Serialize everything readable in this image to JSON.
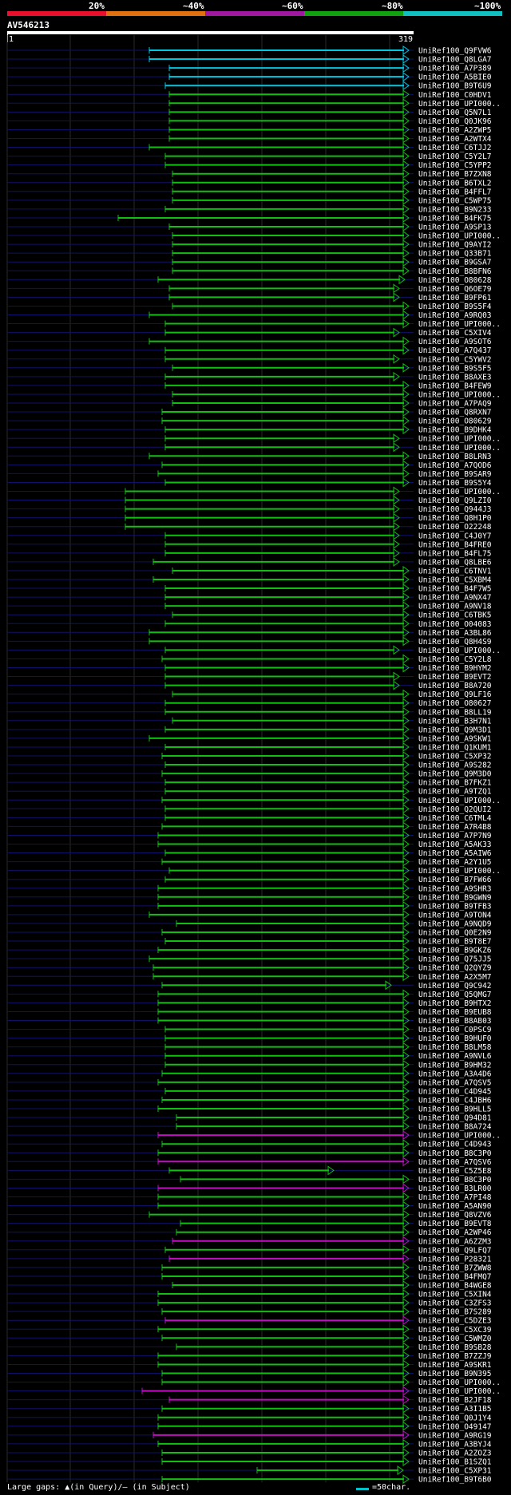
{
  "legend": {
    "labels": [
      "20%",
      "~40%",
      "~60%",
      "~80%",
      "~100%"
    ],
    "colors": [
      "#e8102c",
      "#e07010",
      "#a018a0",
      "#10a010",
      "#10c0c0"
    ]
  },
  "query": {
    "name": "AV546213",
    "start": "1",
    "end": "319"
  },
  "footer": {
    "text": "Large gaps: ▲(in Query)/— (in Subject)",
    "scale_label": "=50char."
  },
  "identity_colors": {
    "cyan": "#00c8e0",
    "green": "#10c010",
    "magenta": "#c010c0",
    "query_line": "#101068"
  },
  "hits": [
    {
      "id": "UniRef100_Q9FVW6",
      "start": 187,
      "end": 512,
      "color": "cyan"
    },
    {
      "id": "UniRef100_Q8LGA7",
      "start": 187,
      "end": 512,
      "color": "cyan"
    },
    {
      "id": "UniRef100_A7P389",
      "start": 212,
      "end": 512,
      "color": "cyan"
    },
    {
      "id": "UniRef100_A5BIE0",
      "start": 212,
      "end": 512,
      "color": "cyan"
    },
    {
      "id": "UniRef100_B9T6U9",
      "start": 207,
      "end": 512,
      "color": "cyan"
    },
    {
      "id": "UniRef100_C0HDV1",
      "start": 212,
      "end": 512,
      "color": "green"
    },
    {
      "id": "UniRef100_UPI000..",
      "start": 212,
      "end": 512,
      "color": "green"
    },
    {
      "id": "UniRef100_Q5N7L1",
      "start": 212,
      "end": 512,
      "color": "green"
    },
    {
      "id": "UniRef100_Q0JK96",
      "start": 212,
      "end": 512,
      "color": "green"
    },
    {
      "id": "UniRef100_A2ZWP5",
      "start": 212,
      "end": 512,
      "color": "green"
    },
    {
      "id": "UniRef100_A2WTX4",
      "start": 212,
      "end": 512,
      "color": "green"
    },
    {
      "id": "UniRef100_C6TJJ2",
      "start": 187,
      "end": 512,
      "color": "green"
    },
    {
      "id": "UniRef100_C5Y2L7",
      "start": 207,
      "end": 512,
      "color": "green"
    },
    {
      "id": "UniRef100_C5YPP2",
      "start": 207,
      "end": 512,
      "color": "green"
    },
    {
      "id": "UniRef100_B7ZXN8",
      "start": 216,
      "end": 512,
      "color": "green"
    },
    {
      "id": "UniRef100_B6TXL2",
      "start": 216,
      "end": 512,
      "color": "green"
    },
    {
      "id": "UniRef100_B4FFL7",
      "start": 216,
      "end": 512,
      "color": "green"
    },
    {
      "id": "UniRef100_C5WP75",
      "start": 216,
      "end": 512,
      "color": "green"
    },
    {
      "id": "UniRef100_B9N233",
      "start": 207,
      "end": 512,
      "color": "green"
    },
    {
      "id": "UniRef100_B4FK75",
      "start": 148,
      "end": 512,
      "color": "green"
    },
    {
      "id": "UniRef100_A9SP13",
      "start": 212,
      "end": 512,
      "color": "green"
    },
    {
      "id": "UniRef100_UPI000..",
      "start": 216,
      "end": 512,
      "color": "green"
    },
    {
      "id": "UniRef100_Q9AYI2",
      "start": 216,
      "end": 512,
      "color": "green"
    },
    {
      "id": "UniRef100_Q33B71",
      "start": 216,
      "end": 512,
      "color": "green"
    },
    {
      "id": "UniRef100_B9GSA7",
      "start": 216,
      "end": 512,
      "color": "green"
    },
    {
      "id": "UniRef100_B8BFN6",
      "start": 216,
      "end": 512,
      "color": "green"
    },
    {
      "id": "UniRef100_O80628",
      "start": 198,
      "end": 507,
      "color": "green"
    },
    {
      "id": "UniRef100_Q6OE79",
      "start": 212,
      "end": 500,
      "color": "green"
    },
    {
      "id": "UniRef100_B9FP61",
      "start": 212,
      "end": 500,
      "color": "green"
    },
    {
      "id": "UniRef100_B9S5F4",
      "start": 216,
      "end": 512,
      "color": "green"
    },
    {
      "id": "UniRef100_A9RQ03",
      "start": 187,
      "end": 512,
      "color": "green"
    },
    {
      "id": "UniRef100_UPI000..",
      "start": 207,
      "end": 512,
      "color": "green"
    },
    {
      "id": "UniRef100_C5XIV4",
      "start": 207,
      "end": 500,
      "color": "green"
    },
    {
      "id": "UniRef100_A9SOT6",
      "start": 187,
      "end": 512,
      "color": "green"
    },
    {
      "id": "UniRef100_A7Q437",
      "start": 207,
      "end": 512,
      "color": "green"
    },
    {
      "id": "UniRef100_C5YWV2",
      "start": 207,
      "end": 500,
      "color": "green"
    },
    {
      "id": "UniRef100_B9S5F5",
      "start": 216,
      "end": 512,
      "color": "green"
    },
    {
      "id": "UniRef100_B8AXE3",
      "start": 207,
      "end": 500,
      "color": "green"
    },
    {
      "id": "UniRef100_B4FEW9",
      "start": 207,
      "end": 512,
      "color": "green"
    },
    {
      "id": "UniRef100_UPI000..",
      "start": 216,
      "end": 512,
      "color": "green"
    },
    {
      "id": "UniRef100_A7PAQ9",
      "start": 216,
      "end": 512,
      "color": "green"
    },
    {
      "id": "UniRef100_Q8RXN7",
      "start": 203,
      "end": 512,
      "color": "green"
    },
    {
      "id": "UniRef100_O80629",
      "start": 203,
      "end": 512,
      "color": "green"
    },
    {
      "id": "UniRef100_B9DHK4",
      "start": 207,
      "end": 512,
      "color": "green"
    },
    {
      "id": "UniRef100_UPI000..",
      "start": 207,
      "end": 500,
      "color": "green"
    },
    {
      "id": "UniRef100_UPI000..",
      "start": 207,
      "end": 500,
      "color": "green"
    },
    {
      "id": "UniRef100_B8LRN3",
      "start": 187,
      "end": 512,
      "color": "green"
    },
    {
      "id": "UniRef100_A7QOD6",
      "start": 203,
      "end": 512,
      "color": "green"
    },
    {
      "id": "UniRef100_B9SAR9",
      "start": 198,
      "end": 512,
      "color": "green"
    },
    {
      "id": "UniRef100_B9S5Y4",
      "start": 207,
      "end": 512,
      "color": "green"
    },
    {
      "id": "UniRef100_UPI000..",
      "start": 157,
      "end": 500,
      "color": "green"
    },
    {
      "id": "UniRef100_Q9LZI0",
      "start": 157,
      "end": 500,
      "color": "green"
    },
    {
      "id": "UniRef100_Q944J3",
      "start": 157,
      "end": 500,
      "color": "green"
    },
    {
      "id": "UniRef100_Q8H1P0",
      "start": 157,
      "end": 500,
      "color": "green"
    },
    {
      "id": "UniRef100_O22248",
      "start": 157,
      "end": 500,
      "color": "green"
    },
    {
      "id": "UniRef100_C4J0Y7",
      "start": 207,
      "end": 500,
      "color": "green"
    },
    {
      "id": "UniRef100_B4FRE0",
      "start": 207,
      "end": 500,
      "color": "green"
    },
    {
      "id": "UniRef100_B4FL75",
      "start": 207,
      "end": 500,
      "color": "green"
    },
    {
      "id": "UniRef100_Q8LBE6",
      "start": 192,
      "end": 500,
      "color": "green"
    },
    {
      "id": "UniRef100_C6TNV1",
      "start": 216,
      "end": 512,
      "color": "green"
    },
    {
      "id": "UniRef100_C5XBM4",
      "start": 192,
      "end": 512,
      "color": "green"
    },
    {
      "id": "UniRef100_B4F7W5",
      "start": 207,
      "end": 512,
      "color": "green"
    },
    {
      "id": "UniRef100_A9NX47",
      "start": 207,
      "end": 512,
      "color": "green"
    },
    {
      "id": "UniRef100_A9NV18",
      "start": 207,
      "end": 512,
      "color": "green"
    },
    {
      "id": "UniRef100_C6TBK5",
      "start": 216,
      "end": 512,
      "color": "green"
    },
    {
      "id": "UniRef100_O04083",
      "start": 207,
      "end": 512,
      "color": "green"
    },
    {
      "id": "UniRef100_A3BL86",
      "start": 187,
      "end": 512,
      "color": "green"
    },
    {
      "id": "UniRef100_Q8H4S9",
      "start": 187,
      "end": 512,
      "color": "green"
    },
    {
      "id": "UniRef100_UPI000..",
      "start": 207,
      "end": 500,
      "color": "green"
    },
    {
      "id": "UniRef100_C5Y2L8",
      "start": 203,
      "end": 512,
      "color": "green"
    },
    {
      "id": "UniRef100_B9HYM2",
      "start": 207,
      "end": 512,
      "color": "green"
    },
    {
      "id": "UniRef100_B9EVT2",
      "start": 207,
      "end": 500,
      "color": "green"
    },
    {
      "id": "UniRef100_B8A720",
      "start": 207,
      "end": 500,
      "color": "green"
    },
    {
      "id": "UniRef100_Q9LF16",
      "start": 216,
      "end": 512,
      "color": "green"
    },
    {
      "id": "UniRef100_O80627",
      "start": 207,
      "end": 512,
      "color": "green"
    },
    {
      "id": "UniRef100_B8LL19",
      "start": 207,
      "end": 512,
      "color": "green"
    },
    {
      "id": "UniRef100_B3H7N1",
      "start": 216,
      "end": 512,
      "color": "green"
    },
    {
      "id": "UniRef100_Q9M3D1",
      "start": 207,
      "end": 512,
      "color": "green"
    },
    {
      "id": "UniRef100_A9SKW1",
      "start": 187,
      "end": 512,
      "color": "green"
    },
    {
      "id": "UniRef100_Q1KUM1",
      "start": 207,
      "end": 512,
      "color": "green"
    },
    {
      "id": "UniRef100_C5XP32",
      "start": 203,
      "end": 512,
      "color": "green"
    },
    {
      "id": "UniRef100_A9S282",
      "start": 207,
      "end": 512,
      "color": "green"
    },
    {
      "id": "UniRef100_Q9M3D0",
      "start": 203,
      "end": 512,
      "color": "green"
    },
    {
      "id": "UniRef100_B7FKZ1",
      "start": 207,
      "end": 512,
      "color": "green"
    },
    {
      "id": "UniRef100_A9TZQ1",
      "start": 207,
      "end": 512,
      "color": "green"
    },
    {
      "id": "UniRef100_UPI000..",
      "start": 203,
      "end": 512,
      "color": "green"
    },
    {
      "id": "UniRef100_Q2QUI2",
      "start": 207,
      "end": 512,
      "color": "green"
    },
    {
      "id": "UniRef100_C6TML4",
      "start": 207,
      "end": 512,
      "color": "green"
    },
    {
      "id": "UniRef100_A7R4B8",
      "start": 203,
      "end": 512,
      "color": "green"
    },
    {
      "id": "UniRef100_A7P7N9",
      "start": 198,
      "end": 512,
      "color": "green"
    },
    {
      "id": "UniRef100_A5AK33",
      "start": 198,
      "end": 512,
      "color": "green"
    },
    {
      "id": "UniRef100_A5AIW6",
      "start": 207,
      "end": 512,
      "color": "green"
    },
    {
      "id": "UniRef100_A2Y1U5",
      "start": 203,
      "end": 512,
      "color": "green"
    },
    {
      "id": "UniRef100_UPI000..",
      "start": 212,
      "end": 512,
      "color": "green"
    },
    {
      "id": "UniRef100_B7FW66",
      "start": 207,
      "end": 512,
      "color": "green"
    },
    {
      "id": "UniRef100_A9SHR3",
      "start": 198,
      "end": 512,
      "color": "green"
    },
    {
      "id": "UniRef100_B9GWN9",
      "start": 198,
      "end": 512,
      "color": "green"
    },
    {
      "id": "UniRef100_B9TFB3",
      "start": 198,
      "end": 512,
      "color": "green"
    },
    {
      "id": "UniRef100_A9TON4",
      "start": 187,
      "end": 512,
      "color": "green"
    },
    {
      "id": "UniRef100_A9NQD9",
      "start": 221,
      "end": 512,
      "color": "green"
    },
    {
      "id": "UniRef100_Q0E2N9",
      "start": 203,
      "end": 512,
      "color": "green"
    },
    {
      "id": "UniRef100_B9T8E7",
      "start": 207,
      "end": 512,
      "color": "green"
    },
    {
      "id": "UniRef100_B9GKZ6",
      "start": 198,
      "end": 512,
      "color": "green"
    },
    {
      "id": "UniRef100_Q75JJ5",
      "start": 187,
      "end": 512,
      "color": "green"
    },
    {
      "id": "UniRef100_Q2QYZ9",
      "start": 192,
      "end": 512,
      "color": "green"
    },
    {
      "id": "UniRef100_A2X5M7",
      "start": 192,
      "end": 512,
      "color": "green"
    },
    {
      "id": "UniRef100_Q9C942",
      "start": 203,
      "end": 490,
      "color": "green"
    },
    {
      "id": "UniRef100_Q5QMG7",
      "start": 198,
      "end": 512,
      "color": "green"
    },
    {
      "id": "UniRef100_B9HTX2",
      "start": 198,
      "end": 512,
      "color": "green"
    },
    {
      "id": "UniRef100_B9EUB8",
      "start": 198,
      "end": 512,
      "color": "green"
    },
    {
      "id": "UniRef100_B8AB03",
      "start": 198,
      "end": 512,
      "color": "green"
    },
    {
      "id": "UniRef100_C0PSC9",
      "start": 207,
      "end": 512,
      "color": "green"
    },
    {
      "id": "UniRef100_B9HUF0",
      "start": 207,
      "end": 512,
      "color": "green"
    },
    {
      "id": "UniRef100_B8LM58",
      "start": 207,
      "end": 512,
      "color": "green"
    },
    {
      "id": "UniRef100_A9NVL6",
      "start": 207,
      "end": 512,
      "color": "green"
    },
    {
      "id": "UniRef100_B9HM32",
      "start": 207,
      "end": 512,
      "color": "green"
    },
    {
      "id": "UniRef100_A3A4D6",
      "start": 203,
      "end": 512,
      "color": "green"
    },
    {
      "id": "UniRef100_A7QSV5",
      "start": 198,
      "end": 512,
      "color": "green"
    },
    {
      "id": "UniRef100_C4D945",
      "start": 207,
      "end": 512,
      "color": "green"
    },
    {
      "id": "UniRef100_C4JBH6",
      "start": 203,
      "end": 512,
      "color": "green"
    },
    {
      "id": "UniRef100_B9HLL5",
      "start": 198,
      "end": 512,
      "color": "green"
    },
    {
      "id": "UniRef100_Q94D81",
      "start": 221,
      "end": 512,
      "color": "green"
    },
    {
      "id": "UniRef100_B8A724",
      "start": 221,
      "end": 512,
      "color": "green"
    },
    {
      "id": "UniRef100_UPI000..",
      "start": 198,
      "end": 512,
      "color": "magenta"
    },
    {
      "id": "UniRef100_C4D943",
      "start": 203,
      "end": 512,
      "color": "green"
    },
    {
      "id": "UniRef100_B8C3P0",
      "start": 198,
      "end": 512,
      "color": "green"
    },
    {
      "id": "UniRef100_A7QSV6",
      "start": 198,
      "end": 512,
      "color": "magenta"
    },
    {
      "id": "UniRef100_C5Z5E8",
      "start": 212,
      "end": 418,
      "color": "green"
    },
    {
      "id": "UniRef100_B8C3P0",
      "start": 226,
      "end": 512,
      "color": "green"
    },
    {
      "id": "UniRef100_B3LR00",
      "start": 198,
      "end": 512,
      "color": "magenta"
    },
    {
      "id": "UniRef100_A7PI48",
      "start": 198,
      "end": 512,
      "color": "green"
    },
    {
      "id": "UniRef100_A5AN90",
      "start": 198,
      "end": 512,
      "color": "green"
    },
    {
      "id": "UniRef100_Q8VZV6",
      "start": 187,
      "end": 512,
      "color": "green"
    },
    {
      "id": "UniRef100_B9EVT8",
      "start": 226,
      "end": 512,
      "color": "green"
    },
    {
      "id": "UniRef100_A2WP46",
      "start": 221,
      "end": 512,
      "color": "green"
    },
    {
      "id": "UniRef100_A6ZZM3",
      "start": 216,
      "end": 512,
      "color": "magenta"
    },
    {
      "id": "UniRef100_Q9LFQ7",
      "start": 207,
      "end": 512,
      "color": "green"
    },
    {
      "id": "UniRef100_P28321",
      "start": 212,
      "end": 512,
      "color": "magenta"
    },
    {
      "id": "UniRef100_B7ZWW8",
      "start": 203,
      "end": 512,
      "color": "green"
    },
    {
      "id": "UniRef100_B4FMQ7",
      "start": 203,
      "end": 512,
      "color": "green"
    },
    {
      "id": "UniRef100_B4WGE8",
      "start": 216,
      "end": 512,
      "color": "green"
    },
    {
      "id": "UniRef100_C5XIN4",
      "start": 198,
      "end": 512,
      "color": "green"
    },
    {
      "id": "UniRef100_C3ZFS3",
      "start": 198,
      "end": 512,
      "color": "green"
    },
    {
      "id": "UniRef100_B7S289",
      "start": 203,
      "end": 512,
      "color": "green"
    },
    {
      "id": "UniRef100_C5DZE3",
      "start": 207,
      "end": 512,
      "color": "magenta"
    },
    {
      "id": "UniRef100_C5XC39",
      "start": 198,
      "end": 512,
      "color": "green"
    },
    {
      "id": "UniRef100_C5WMZ0",
      "start": 203,
      "end": 512,
      "color": "green"
    },
    {
      "id": "UniRef100_B9SB28",
      "start": 221,
      "end": 512,
      "color": "green"
    },
    {
      "id": "UniRef100_B7ZZJ9",
      "start": 198,
      "end": 512,
      "color": "green"
    },
    {
      "id": "UniRef100_A9SKR1",
      "start": 198,
      "end": 512,
      "color": "green"
    },
    {
      "id": "UniRef100_B9N395",
      "start": 203,
      "end": 512,
      "color": "green"
    },
    {
      "id": "UniRef100_UPI000..",
      "start": 203,
      "end": 512,
      "color": "green"
    },
    {
      "id": "UniRef100_UPI000..",
      "start": 178,
      "end": 512,
      "color": "magenta"
    },
    {
      "id": "UniRef100_B2JF18",
      "start": 212,
      "end": 512,
      "color": "magenta"
    },
    {
      "id": "UniRef100_A3I1B5",
      "start": 203,
      "end": 512,
      "color": "green"
    },
    {
      "id": "UniRef100_Q0J1Y4",
      "start": 198,
      "end": 512,
      "color": "green"
    },
    {
      "id": "UniRef100_O49147",
      "start": 198,
      "end": 512,
      "color": "green"
    },
    {
      "id": "UniRef100_A9RG19",
      "start": 192,
      "end": 512,
      "color": "magenta"
    },
    {
      "id": "UniRef100_A3BYJ4",
      "start": 198,
      "end": 512,
      "color": "green"
    },
    {
      "id": "UniRef100_A2ZOZ3",
      "start": 203,
      "end": 512,
      "color": "green"
    },
    {
      "id": "UniRef100_B1SZQ1",
      "start": 203,
      "end": 512,
      "color": "green"
    },
    {
      "id": "UniRef100_C5XP31",
      "start": 322,
      "end": 505,
      "color": "green"
    },
    {
      "id": "UniRef100_B9T6B0",
      "start": 203,
      "end": 512,
      "color": "green"
    }
  ]
}
